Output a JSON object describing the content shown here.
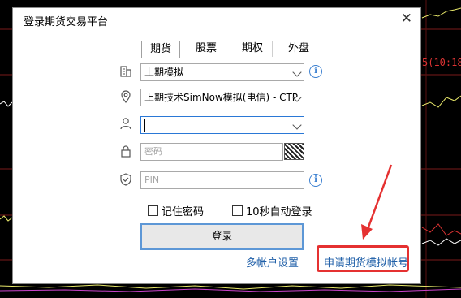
{
  "background": {
    "ticker_text": "5(10:18",
    "colors": {
      "background": "#000000",
      "price_up": "#dd3333",
      "ma_line": "#e8e86a"
    }
  },
  "dialog": {
    "title": "登录期货交易平台",
    "close_icon": "close-icon",
    "tabs": [
      {
        "label": "期货",
        "active": true
      },
      {
        "label": "股票",
        "active": false
      },
      {
        "label": "期权",
        "active": false
      },
      {
        "label": "外盘",
        "active": false
      }
    ],
    "broker_select": {
      "value": "上期模拟",
      "icon": "building-icon"
    },
    "server_select": {
      "value": "上期技术SimNow模拟(电信) - CTP",
      "icon": "location-pin-icon"
    },
    "account_input": {
      "value": "",
      "icon": "user-icon"
    },
    "password_input": {
      "placeholder": "密码",
      "icon": "lock-icon"
    },
    "pin_input": {
      "placeholder": "PIN",
      "icon": "shield-icon"
    },
    "info_icon_glyph": "i",
    "remember_password": {
      "label": "记住密码",
      "checked": false
    },
    "auto_login": {
      "label": "10秒自动登录",
      "checked": false
    },
    "login_button": "登录",
    "multi_account_link": "多帐户设置",
    "apply_sim_link": "申请期货模拟帐号",
    "accent_color": "#3a7fd0",
    "highlight_color": "#e53131"
  }
}
